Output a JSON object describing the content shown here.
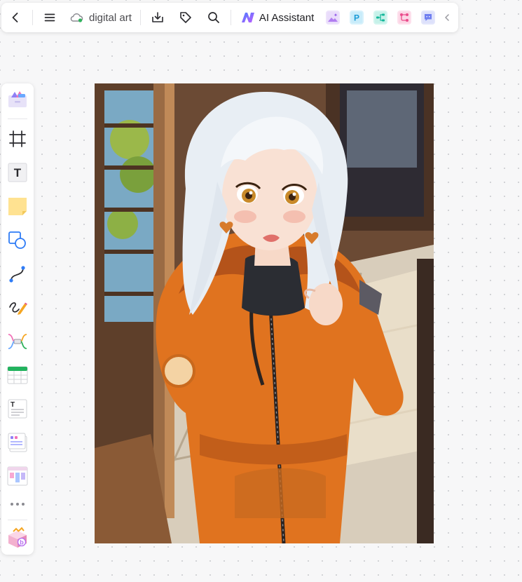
{
  "toolbar": {
    "document_title": "digital art",
    "ai_assistant_label": "AI Assistant",
    "icons": [
      "back-arrow-icon",
      "menu-icon",
      "cloud-sync-icon",
      "download-icon",
      "tag-icon",
      "search-icon",
      "ai-assistant-logo-icon",
      "image-ai-app-icon",
      "presentation-app-icon",
      "mindmap-app-icon",
      "flowchart-app-icon",
      "chat-app-icon",
      "collapse-chevron-icon"
    ],
    "app_icon_text": {
      "presentation": "P"
    }
  },
  "sidebar": {
    "tools": [
      "templates",
      "frame",
      "text",
      "sticky-note",
      "shapes",
      "connector",
      "pen",
      "mindmap",
      "table",
      "text-block",
      "list-card",
      "kanban",
      "more",
      "toolbox"
    ],
    "text_tool_glyph": "T",
    "text_block_glyph": "T",
    "toolbox_badge": "b"
  },
  "canvas": {
    "image_subject": "anime girl with silver hair in orange hoodie"
  },
  "colors": {
    "accent": "#5b6cf0",
    "hoodie_orange": "#e0731f",
    "hair_silver": "#e8eef4"
  }
}
